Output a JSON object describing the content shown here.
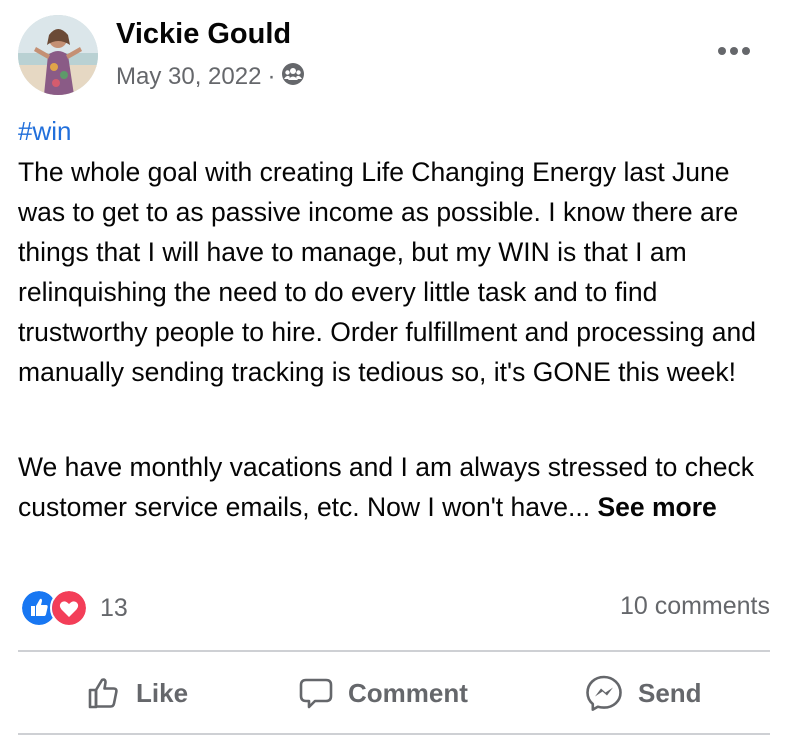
{
  "post": {
    "author": "Vickie Gould",
    "date": "May 30, 2022",
    "separator": "·",
    "audience_icon": "group-icon",
    "hashtag": "#win",
    "paragraph1": "The whole goal with creating Life Changing Energy last June was to get to as passive income as possible. I know there are things that I will have to manage, but my WIN is that I am relinquishing the need to do every little task and to find trustworthy people to hire. Order fulfillment and processing and manually sending tracking is tedious so, it's GONE this week!",
    "paragraph2": "We have monthly vacations and I am always stressed to check customer service emails, etc. Now I won't have...",
    "see_more": "See more"
  },
  "reactions": {
    "icons": [
      "like-reaction-icon",
      "love-reaction-icon"
    ],
    "count": "13",
    "comments": "10 comments"
  },
  "actions": {
    "like": "Like",
    "comment": "Comment",
    "send": "Send"
  },
  "colors": {
    "hashtag": "#216fdb",
    "secondary_text": "#65676b",
    "like_blue": "#1877f2",
    "love_red": "#f33e58",
    "divider": "#ced0d4"
  }
}
